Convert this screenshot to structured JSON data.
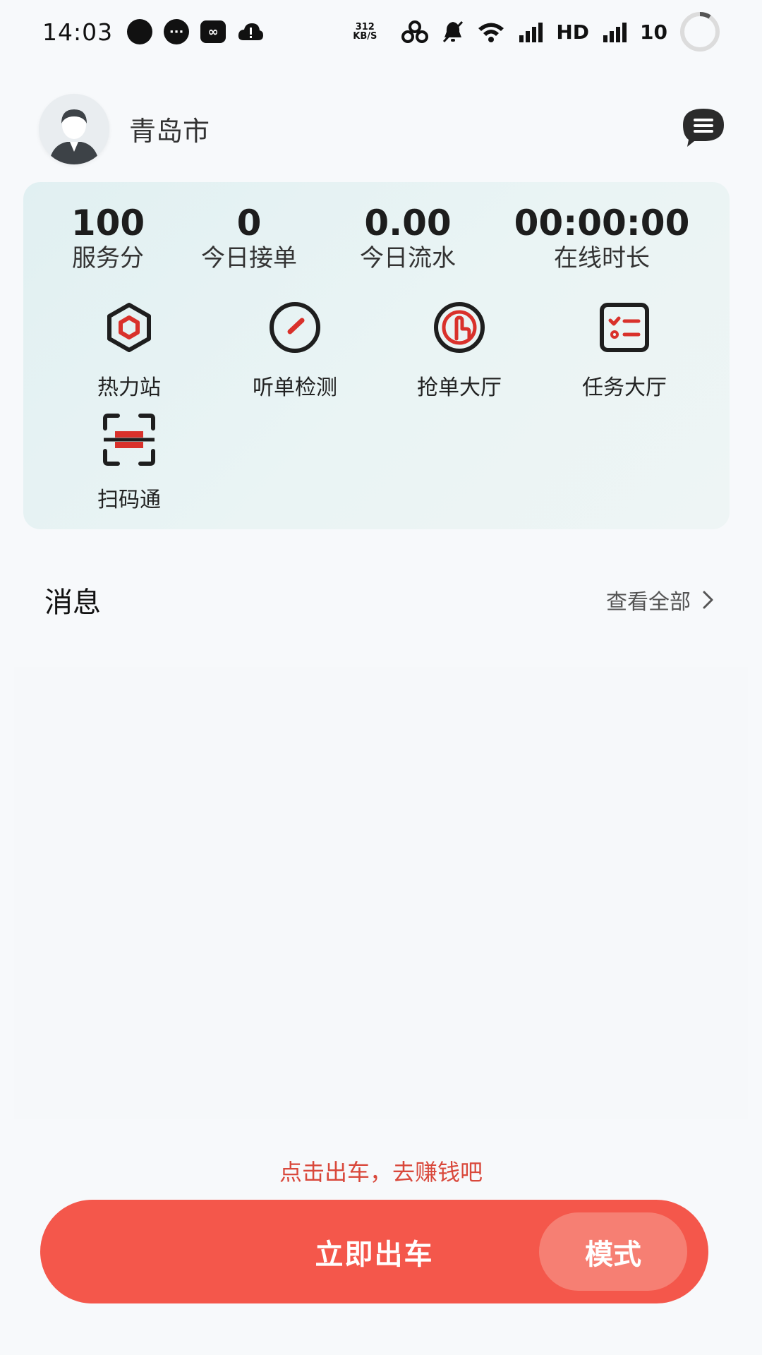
{
  "status_bar": {
    "time": "14:03",
    "net_speed_value": "312",
    "net_speed_unit": "KB/S",
    "hd_label": "HD",
    "battery_level": "10",
    "icons": [
      "notification-dot-icon",
      "chat-bubble-icon",
      "infinity-app-icon",
      "cloud-warning-icon",
      "speed-icon",
      "link-icon",
      "bell-muted-icon",
      "wifi-icon",
      "signal-icon",
      "signal-icon",
      "battery-ring-icon"
    ]
  },
  "header": {
    "city": "青岛市",
    "avatar_icon": "user-avatar-icon",
    "message_icon": "message-menu-icon"
  },
  "stats": [
    {
      "value": "100",
      "label": "服务分"
    },
    {
      "value": "0",
      "label": "今日接单"
    },
    {
      "value": "0.00",
      "label": "今日流水"
    },
    {
      "value": "00:00:00",
      "label": "在线时长"
    }
  ],
  "tools": [
    {
      "label": "热力站",
      "icon": "hexagon-icon"
    },
    {
      "label": "听单检测",
      "icon": "gauge-icon"
    },
    {
      "label": "抢单大厅",
      "icon": "tap-finger-icon"
    },
    {
      "label": "任务大厅",
      "icon": "task-list-icon"
    },
    {
      "label": "扫码通",
      "icon": "scan-code-icon"
    }
  ],
  "messages": {
    "title": "消息",
    "view_all": "查看全部"
  },
  "bottom": {
    "hint": "点击出车，去赚钱吧",
    "go_label": "立即出车",
    "mode_label": "模式"
  },
  "colors": {
    "accent_red": "#f4574b",
    "hint_red": "#d9483b",
    "card_bg": "#e1f0f2"
  }
}
